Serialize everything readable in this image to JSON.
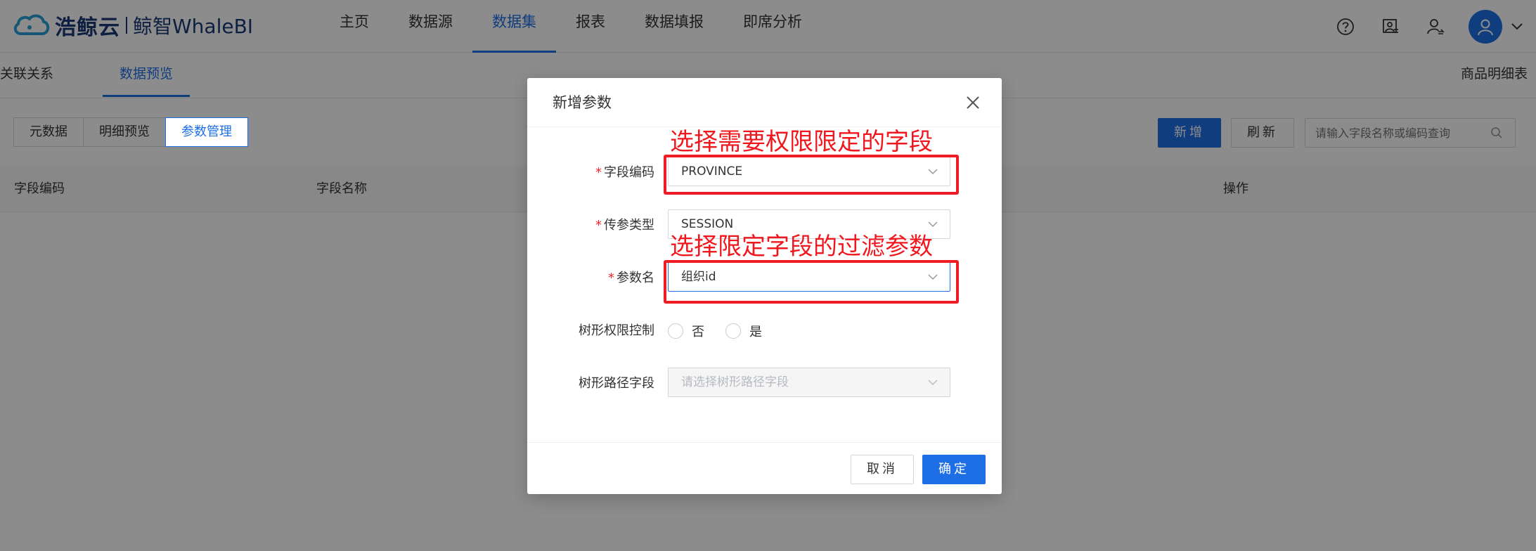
{
  "brand": {
    "logo_text": "浩鲸云",
    "product": "鲸智WhaleBI"
  },
  "nav": {
    "items": [
      {
        "label": "主页"
      },
      {
        "label": "数据源"
      },
      {
        "label": "数据集"
      },
      {
        "label": "报表"
      },
      {
        "label": "数据填报"
      },
      {
        "label": "即席分析"
      }
    ],
    "active_index": 2
  },
  "top_icons": [
    "help-icon",
    "image-text-icon",
    "user-switch-icon",
    "user-avatar-icon",
    "chevron-down-icon"
  ],
  "subtabs": {
    "items": [
      {
        "label": "关联关系"
      },
      {
        "label": "数据预览"
      }
    ],
    "active_index": 1,
    "dataset_name": "商品明细表"
  },
  "toolbar": {
    "segments": [
      {
        "label": "元数据"
      },
      {
        "label": "明细预览"
      },
      {
        "label": "参数管理"
      }
    ],
    "active_segment": 2,
    "add_label": "新增",
    "refresh_label": "刷新",
    "search_placeholder": "请输入字段名称或编码查询"
  },
  "table": {
    "columns": [
      "字段编码",
      "字段名称",
      "操作"
    ]
  },
  "modal": {
    "title": "新增参数",
    "fields": {
      "field_code": {
        "label": "字段编码",
        "required": true,
        "value": "PROVINCE"
      },
      "param_type": {
        "label": "传参类型",
        "required": true,
        "value": "SESSION"
      },
      "param_name": {
        "label": "参数名",
        "required": true,
        "value": "组织id"
      },
      "tree_control": {
        "label": "树形权限控制",
        "required": false,
        "options": [
          "否",
          "是"
        ]
      },
      "tree_path": {
        "label": "树形路径字段",
        "required": false,
        "placeholder": "请选择树形路径字段"
      }
    },
    "cancel_label": "取消",
    "ok_label": "确定"
  },
  "annotations": {
    "field_hint": "选择需要权限限定的字段",
    "param_hint": "选择限定字段的过滤参数",
    "color": "#ee1c25"
  },
  "colors": {
    "accent": "#1e6fe6",
    "required": "#f5222d",
    "annotation": "#ee1c25"
  }
}
